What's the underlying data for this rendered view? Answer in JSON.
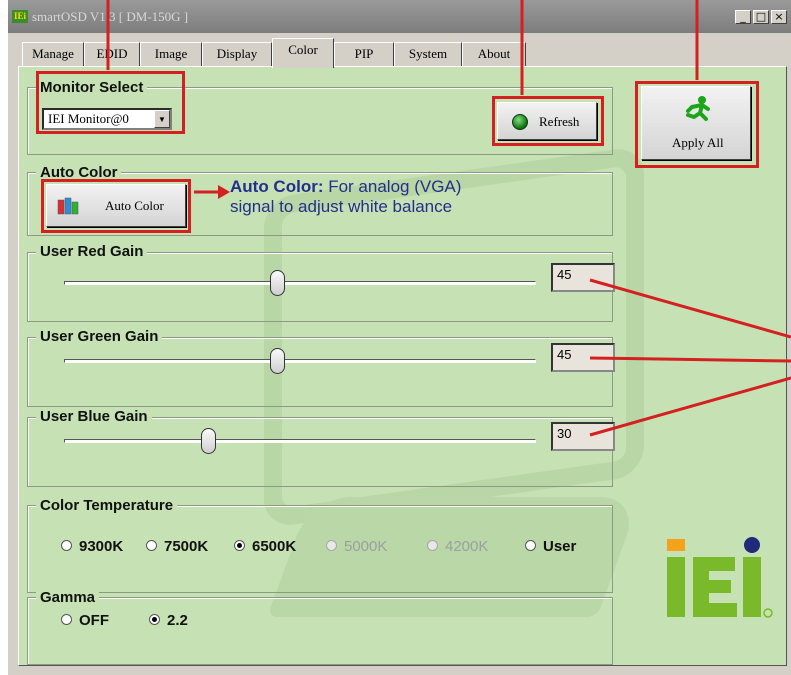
{
  "window": {
    "title": "smartOSD V1.3 [ DM-150G ]",
    "app_icon": "IEi",
    "controls": [
      "_",
      "□",
      "×"
    ]
  },
  "tabs": [
    "Manage",
    "EDID",
    "Image",
    "Display",
    "Color",
    "PIP",
    "System",
    "About"
  ],
  "active_tab": "Color",
  "monitor_select": {
    "label": "Monitor Select",
    "value": "IEI Monitor@0"
  },
  "refresh_button": {
    "label": "Refresh",
    "icon": "green-led-icon"
  },
  "apply_all_button": {
    "label": "Apply All",
    "icon": "running-man-icon"
  },
  "auto_color": {
    "group_label": "Auto Color",
    "button_label": "Auto Color",
    "icon": "color-bars-icon"
  },
  "annotation": {
    "bold": "Auto Color:",
    "line1_rest": " For analog (VGA)",
    "line2": "signal to adjust white balance"
  },
  "gains": {
    "red": {
      "label": "User Red Gain",
      "value": "45",
      "level": 45
    },
    "green": {
      "label": "User Green Gain",
      "value": "45",
      "level": 45
    },
    "blue": {
      "label": "User Blue Gain",
      "value": "30",
      "level": 30
    }
  },
  "color_temperature": {
    "label": "Color Temperature",
    "options": [
      {
        "label": "9300K",
        "selected": false,
        "enabled": true
      },
      {
        "label": "7500K",
        "selected": false,
        "enabled": true
      },
      {
        "label": "6500K",
        "selected": true,
        "enabled": true
      },
      {
        "label": "5000K",
        "selected": false,
        "enabled": false
      },
      {
        "label": "4200K",
        "selected": false,
        "enabled": false
      },
      {
        "label": "User",
        "selected": false,
        "enabled": true
      }
    ]
  },
  "gamma": {
    "label": "Gamma",
    "options": [
      {
        "label": "OFF",
        "selected": false
      },
      {
        "label": "2.2",
        "selected": true
      }
    ]
  },
  "logo_text": "iEi",
  "colors": {
    "panel_bg": "#c6e2b4",
    "callout_red": "#d42020",
    "annotation_blue": "#232f8a",
    "logo_green": "#7ab929",
    "logo_orange": "#f4a21c",
    "logo_navy": "#1f2a7a"
  }
}
